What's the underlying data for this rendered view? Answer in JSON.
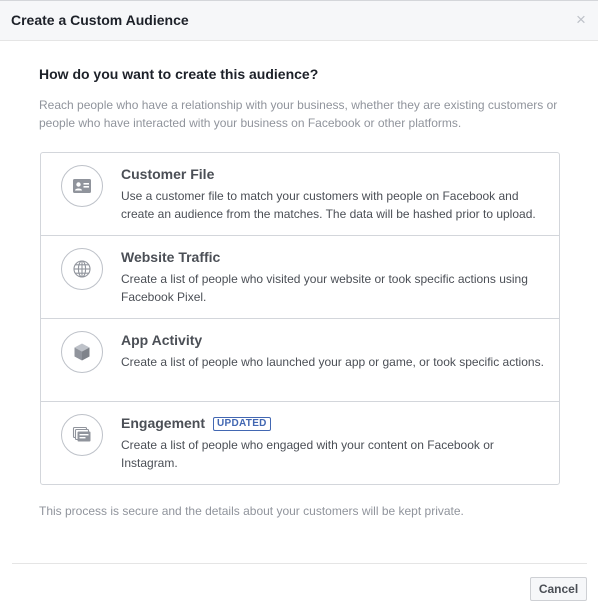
{
  "dialog": {
    "title": "Create a Custom Audience",
    "close_glyph": "×",
    "question": "How do you want to create this audience?",
    "intro": "Reach people who have a relationship with your business, whether they are existing customers or people who have interacted with your business on Facebook or other platforms.",
    "options": [
      {
        "title": "Customer File",
        "badge": "",
        "icon": "contact-card-icon",
        "description": "Use a customer file to match your customers with people on Facebook and create an audience from the matches. The data will be hashed prior to upload."
      },
      {
        "title": "Website Traffic",
        "badge": "",
        "icon": "globe-icon",
        "description": "Create a list of people who visited your website or took specific actions using Facebook Pixel."
      },
      {
        "title": "App Activity",
        "badge": "",
        "icon": "cube-icon",
        "description": "Create a list of people who launched your app or game, or took specific actions."
      },
      {
        "title": "Engagement",
        "badge": "UPDATED",
        "icon": "stacked-cards-icon",
        "description": "Create a list of people who engaged with your content on Facebook or Instagram."
      }
    ],
    "footer_note": "This process is secure and the details about your customers will be kept private.",
    "cancel_label": "Cancel"
  },
  "colors": {
    "header_bg": "#f6f7f9",
    "title_text": "#1d2129",
    "muted_text": "#90949c",
    "body_text": "#4b4f56",
    "border": "#d3d6db",
    "badge_blue": "#4267b2",
    "icon_gray": "#90949c"
  }
}
